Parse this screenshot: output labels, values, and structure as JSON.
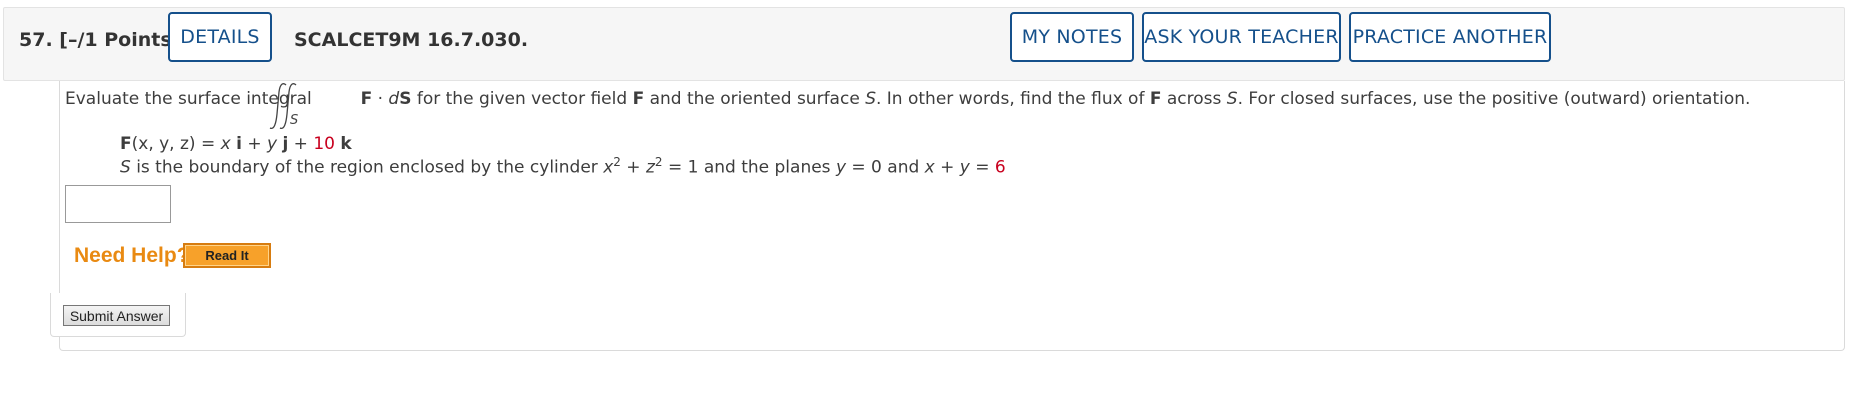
{
  "header": {
    "question_number": "57.",
    "points": "[–/1 Points]",
    "details_label": "DETAILS",
    "code": "SCALCET9M 16.7.030.",
    "my_notes_label": "MY NOTES",
    "ask_teacher_label": "ASK YOUR TEACHER",
    "practice_label": "PRACTICE ANOTHER"
  },
  "question": {
    "intro": "Evaluate the surface integral",
    "integral_subscript": "S",
    "integrand_F": "F",
    "integrand_dot": " · ",
    "integrand_d": "d",
    "integrand_S": "S",
    "text1": " for the given vector field ",
    "F1": "F",
    "text2": " and the oriented surface ",
    "S1": "S",
    "text3": ". In other words, find the flux of ",
    "F2": "F",
    "text4": " across ",
    "S2": "S",
    "text5": ". For closed surfaces, use the positive (outward) orientation.",
    "field": {
      "F": "F",
      "args": "(x, y, z)",
      "eq": " = ",
      "x": "x",
      "i": "i",
      "plus1": " + ",
      "y": "y",
      "j": "j",
      "plus2": " + ",
      "c": "10",
      "k": "k"
    },
    "surface": {
      "S": "S",
      "t1": " is the boundary of the region enclosed by the cylinder ",
      "x": "x",
      "x_exp": "2",
      "plus": " + ",
      "z": "z",
      "z_exp": "2",
      "t2": " = 1 and the planes ",
      "y1": "y",
      "t3": " = 0 and ",
      "x2": "x",
      "plus2": " + ",
      "y2": "y",
      "eq": " = ",
      "c": "6"
    },
    "answer_value": ""
  },
  "help": {
    "need_help": "Need Help?",
    "read_it": "Read It"
  },
  "submit_label": "Submit Answer"
}
